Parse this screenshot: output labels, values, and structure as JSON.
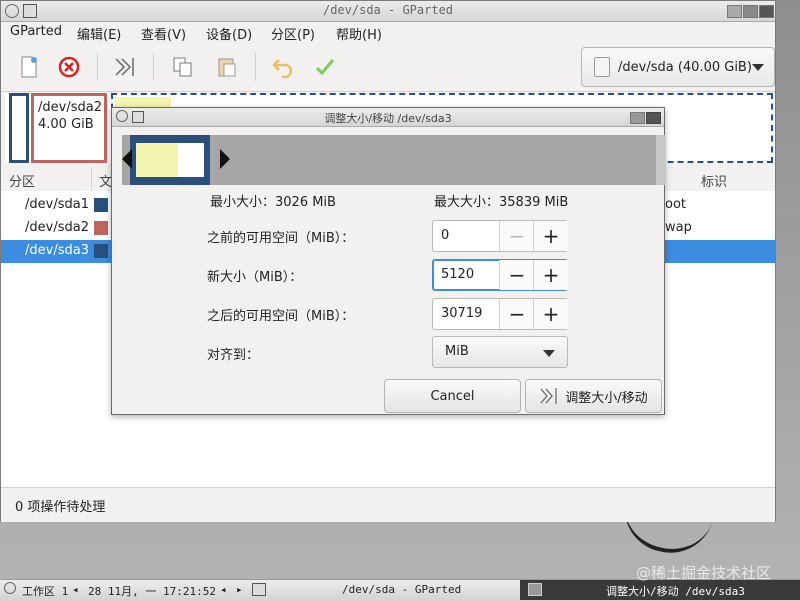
{
  "window": {
    "title": "/dev/sda - GParted"
  },
  "menubar": {
    "items": [
      "GParted",
      "编辑(E)",
      "查看(V)",
      "设备(D)",
      "分区(P)",
      "帮助(H)"
    ]
  },
  "toolbar": {
    "icons": [
      "new-icon",
      "delete-icon",
      "resize-move-icon",
      "copy-icon",
      "paste-icon",
      "undo-icon",
      "apply-icon"
    ]
  },
  "device_selector": {
    "label": "/dev/sda (40.00 GiB)"
  },
  "partition_map": {
    "sda2": {
      "name": "/dev/sda2",
      "size": "4.00 GiB"
    }
  },
  "table": {
    "headers": {
      "partition": "分区",
      "filesystem": "文",
      "label": "标识"
    },
    "rows": [
      {
        "name": "/dev/sda1",
        "color": "#2a4f7a",
        "label_frag": "oot"
      },
      {
        "name": "/dev/sda2",
        "color": "#c0645e",
        "label_frag": "wap"
      },
      {
        "name": "/dev/sda3",
        "color": "#2a4f7a",
        "label_frag": ""
      }
    ]
  },
  "status": {
    "text": "0 项操作待处理"
  },
  "dialog": {
    "title": "调整大小/移动 /dev/sda3",
    "min_size": "最小大小：3026 MiB",
    "max_size": "最大大小：35839 MiB",
    "free_before": {
      "label": "之前的可用空间（MiB）：",
      "value": "0"
    },
    "new_size": {
      "label": "新大小（MiB）：",
      "value": "5120"
    },
    "free_after": {
      "label": "之后的可用空间（MiB）：",
      "value": "30719"
    },
    "align": {
      "label": "对齐到：",
      "value": "MiB"
    },
    "cancel_label": "Cancel",
    "resize_label": "调整大小/移动"
  },
  "taskbar": {
    "workspace": "工作区 1",
    "datetime": "28 11月, 一 17:21:52",
    "task1": "/dev/sda - GParted",
    "task2": "调整大小/移动 /dev/sda3"
  },
  "watermark": "@稀土掘金技术社区"
}
